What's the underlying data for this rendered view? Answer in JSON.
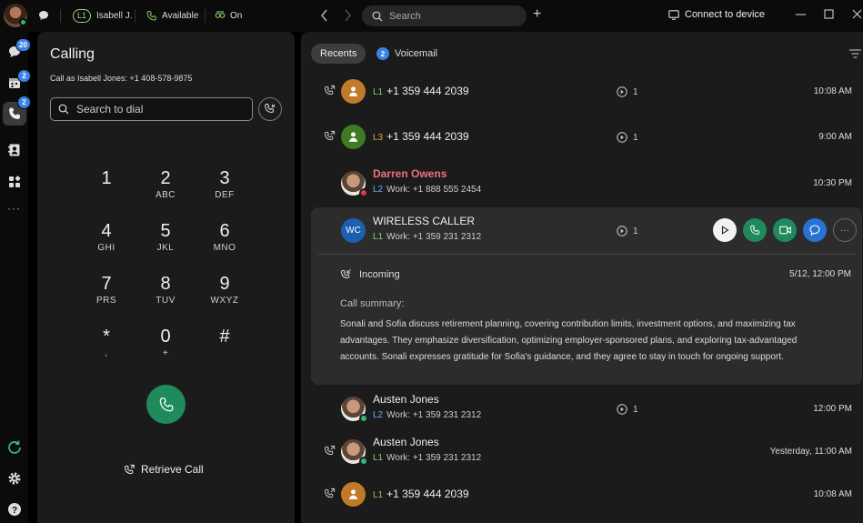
{
  "titlebar": {
    "line_pill": "L1",
    "line_name": "Isabell J.",
    "status": "Available",
    "forwarding": "On",
    "search_placeholder": "Search",
    "connect_label": "Connect to device"
  },
  "rail": {
    "messaging_badge": "20",
    "meetings_badge": "2",
    "calling_badge": "2"
  },
  "dialer": {
    "title": "Calling",
    "call_as": "Call as Isabell Jones: +1 408-578-9875",
    "search_placeholder": "Search to dial",
    "keys": [
      {
        "digit": "1",
        "letters": ""
      },
      {
        "digit": "2",
        "letters": "ABC"
      },
      {
        "digit": "3",
        "letters": "DEF"
      },
      {
        "digit": "4",
        "letters": "GHI"
      },
      {
        "digit": "5",
        "letters": "JKL"
      },
      {
        "digit": "6",
        "letters": "MNO"
      },
      {
        "digit": "7",
        "letters": "PRS"
      },
      {
        "digit": "8",
        "letters": "TUV"
      },
      {
        "digit": "9",
        "letters": "WXYZ"
      },
      {
        "digit": "*",
        "letters": ","
      },
      {
        "digit": "0",
        "letters": "+"
      },
      {
        "digit": "#",
        "letters": ""
      }
    ],
    "retrieve_label": "Retrieve Call"
  },
  "recents": {
    "tab_recents": "Recents",
    "tab_voicemail": "Voicemail",
    "voicemail_badge": "2",
    "rows": [
      {
        "line": "L1",
        "number": "+1 359 444 2039",
        "vm": "1",
        "time": "10:08 AM"
      },
      {
        "line": "L3",
        "number": "+1 359 444 2039",
        "vm": "1",
        "time": "9:00 AM"
      },
      {
        "name": "Darren Owens",
        "line": "L2",
        "detail": "Work: +1 888 555 2454",
        "time": "10:30 PM"
      },
      {
        "initials": "WC",
        "name": "WIRELESS CALLER",
        "line": "L1",
        "detail": "Work: +1 359 231 2312",
        "vm": "1"
      },
      {
        "name": "Austen Jones",
        "line": "L2",
        "detail": "Work: +1 359 231 2312",
        "vm": "1",
        "time": "12:00 PM"
      },
      {
        "name": "Austen Jones",
        "line": "L1",
        "detail": "Work: +1 359 231 2312",
        "time": "Yesterday, 11:00 AM"
      },
      {
        "line": "L1",
        "number": "+1 359 444 2039",
        "time": "10:08 AM"
      }
    ],
    "expanded": {
      "direction": "Incoming",
      "datetime": "5/12, 12:00 PM",
      "summary_label": "Call summary:",
      "summary": "Sonali and Sofia discuss retirement planning, covering contribution limits, investment options, and maximizing tax advantages. They emphasize diversification, optimizing employer-sponsored plans, and exploring tax-advantaged accounts. Sonali expresses gratitude for Sofia's guidance, and they agree to stay in touch for ongoing support."
    }
  }
}
